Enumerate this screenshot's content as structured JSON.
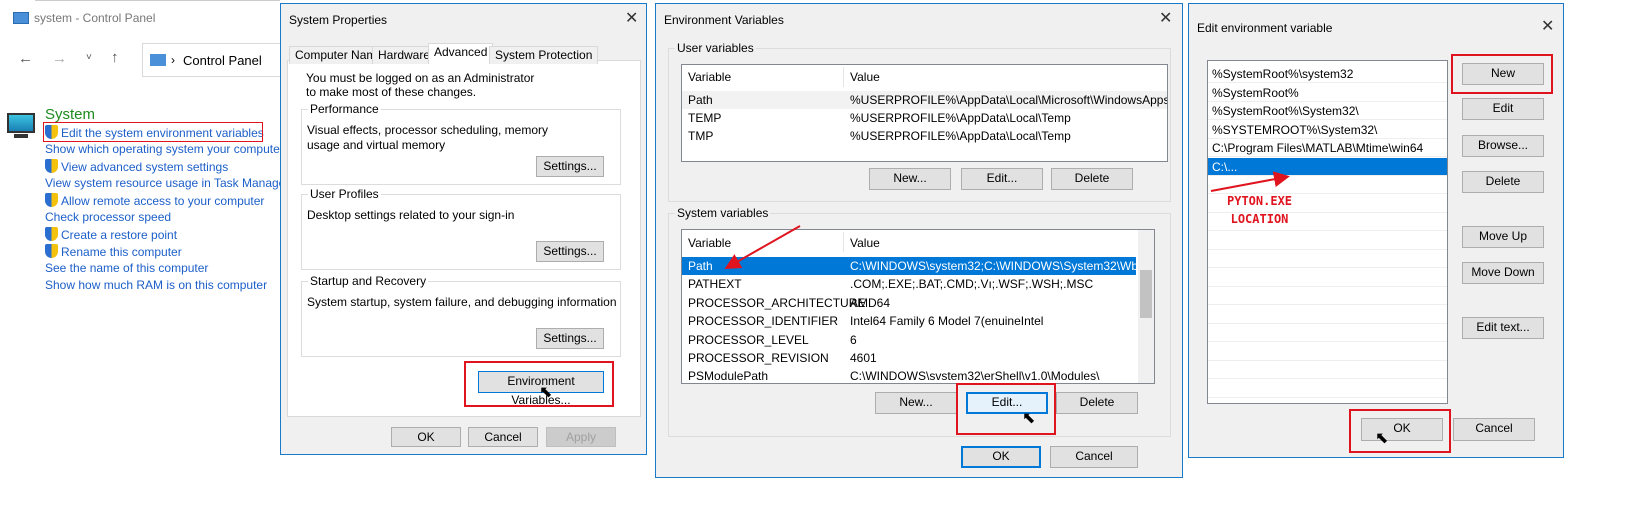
{
  "control_panel": {
    "title": "system - Control Panel",
    "breadcrumb": "Control Panel",
    "heading": "System",
    "links": [
      {
        "label": "Edit the system environment variables",
        "shield": true
      },
      {
        "label": "Show which operating system your compute",
        "shield": false
      },
      {
        "label": "View advanced system settings",
        "shield": true
      },
      {
        "label": "View system resource usage in Task Manager",
        "shield": false
      },
      {
        "label": "Allow remote access to your computer",
        "shield": true
      },
      {
        "label": "Check processor speed",
        "shield": false
      },
      {
        "label": "Create a restore point",
        "shield": true
      },
      {
        "label": "Rename this computer",
        "shield": true
      },
      {
        "label": "See the name of this computer",
        "shield": false
      },
      {
        "label": "Show how much RAM is on this computer",
        "shield": false
      }
    ]
  },
  "system_properties": {
    "title": "System Properties",
    "tabs": [
      "Computer Name",
      "Hardware",
      "Advanced",
      "System Protection"
    ],
    "active_tab": "Advanced",
    "admin_note": "You must be logged on as an Administrator to make most of these changes.",
    "performance": {
      "label": "Performance",
      "desc": "Visual effects, processor scheduling, memory usage and virtual memory",
      "button": "Settings..."
    },
    "user_profiles": {
      "label": "User Profiles",
      "desc": "Desktop settings related to your sign-in",
      "button": "Settings..."
    },
    "startup": {
      "label": "Startup and Recovery",
      "desc": "System startup, system failure, and debugging information",
      "button": "Settings..."
    },
    "env_button": "Environment Variables...",
    "ok": "OK",
    "cancel": "Cancel",
    "apply": "Apply"
  },
  "env_vars": {
    "title": "Environment Variables",
    "user_label": "User variables",
    "col_variable": "Variable",
    "col_value": "Value",
    "user_rows": [
      {
        "name": "Path",
        "value": "%USERPROFILE%\\AppData\\Local\\Microsoft\\WindowsApps;"
      },
      {
        "name": "TEMP",
        "value": "%USERPROFILE%\\AppData\\Local\\Temp"
      },
      {
        "name": "TMP",
        "value": "%USERPROFILE%\\AppData\\Local\\Temp"
      }
    ],
    "system_label": "System variables",
    "system_rows": [
      {
        "name": "Path",
        "value": "C:\\WINDOWS\\system32;C:\\WINDOWS\\System32\\Wb..."
      },
      {
        "name": "PATHEXT",
        "value": ".COM;.EXE;.BAT;.CMD;.Vı;.WSF;.WSH;.MSC"
      },
      {
        "name": "PROCESSOR_ARCHITECTURE",
        "value": "AMD64"
      },
      {
        "name": "PROCESSOR_IDENTIFIER",
        "value": "Intel64 Family 6 Model 7(enuineIntel"
      },
      {
        "name": "PROCESSOR_LEVEL",
        "value": "6"
      },
      {
        "name": "PROCESSOR_REVISION",
        "value": "4601"
      },
      {
        "name": "PSModulePath",
        "value": "C:\\WINDOWS\\svstem32\\erShell\\v1.0\\Modules\\"
      }
    ],
    "new": "New...",
    "edit": "Edit...",
    "delete": "Delete",
    "ok": "OK",
    "cancel": "Cancel"
  },
  "edit_env": {
    "title": "Edit environment variable",
    "items": [
      "%SystemRoot%\\system32",
      "%SystemRoot%",
      "%SystemRoot%\\System32\\",
      "%SYSTEMROOT%\\System32\\",
      "C:\\Program Files\\MATLAB\\Mtime\\win64",
      "C:\\..."
    ],
    "annotation_line1": "PYTON.EXE",
    "annotation_line2": "LOCATION",
    "buttons": {
      "new": "New",
      "edit": "Edit",
      "browse": "Browse...",
      "delete": "Delete",
      "move_up": "Move Up",
      "move_down": "Move Down",
      "edit_text": "Edit text..."
    },
    "ok": "OK",
    "cancel": "Cancel"
  },
  "colors": {
    "selection": "#0078d7",
    "annotation": "#e0141e",
    "link": "#1c5fc9",
    "heading": "#1e8a1e"
  }
}
